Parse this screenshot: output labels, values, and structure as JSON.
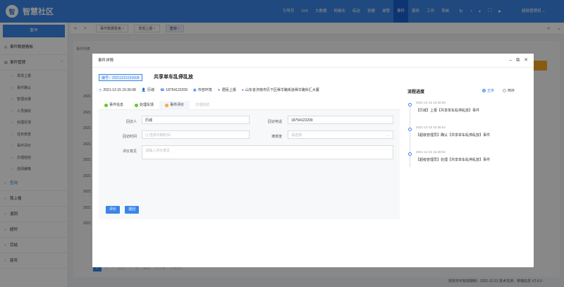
{
  "app": {
    "title": "智慧社区",
    "logo_glyph": "智",
    "accent": "#3a86e8"
  },
  "nav": {
    "items": [
      "引导页",
      "GIS",
      "大数据",
      "网格化",
      "综治",
      "党建",
      "城管",
      "事件",
      "服务",
      "工作",
      "系统"
    ],
    "active_index": 7,
    "user": "超级管理员 ⌄"
  },
  "sidebar": {
    "header": "事件",
    "board": "事件数据看板",
    "group": "事件管理",
    "subs": [
      "发现上报",
      "事件确认",
      "智理派遣",
      "人员接收",
      "处理反馈",
      "任务核查",
      "事件评价",
      "办理结结",
      "自闻编格"
    ],
    "items": [
      "查询",
      "我上报",
      "退回",
      "超时",
      "完结",
      "废弃"
    ]
  },
  "tabs": {
    "items": [
      "事件数据看板",
      "发现上报",
      "查询"
    ],
    "active_index": 2
  },
  "background": {
    "title": "事件列表",
    "rows": [
      "2021",
      "2021",
      "2021",
      "2021",
      "2021",
      "2021",
      "2021",
      "2021",
      "2021"
    ]
  },
  "pager": {
    "current": "1",
    "items": [
      "2",
      ">",
      "前往",
      "1",
      "页",
      "确定",
      "共 9 条",
      "10条/页 ⌄"
    ]
  },
  "footer": "授权许可有效期到：2021-12-31  技术支持：奇瑞信息  V2.6.0",
  "modal": {
    "title": "事件详情",
    "code": "编号：20211215153608",
    "event_title": "共享单车乱停乱放",
    "meta": [
      {
        "icon": "clock-icon",
        "glyph": "◷",
        "text": "2021-12-15 15:36:08"
      },
      {
        "icon": "user-icon",
        "glyph": "👤",
        "text": "历城"
      },
      {
        "icon": "phone-icon",
        "glyph": "☎",
        "text": "18754122209"
      },
      {
        "icon": "tag-icon",
        "glyph": "▣",
        "text": "市容环境"
      },
      {
        "icon": "send-icon",
        "glyph": "➤",
        "text": "居民上报"
      },
      {
        "icon": "location-icon",
        "glyph": "●",
        "text": "山东省济南市历下区舜华路街道舜华路科汇大厦"
      }
    ],
    "inner_tabs": [
      {
        "label": "事件信息",
        "status": "done",
        "color": "#52c41a"
      },
      {
        "label": "处理反馈",
        "status": "done",
        "color": "#52c41a"
      },
      {
        "label": "事件评价",
        "status": "current",
        "color": "#f6a623"
      },
      {
        "label": "办理结结",
        "status": "disabled",
        "color": ""
      }
    ],
    "form": {
      "visitor_label": "回访人",
      "visitor_value": "历城",
      "phone_label": "回访电话",
      "phone_value": "18754122209",
      "time_label": "回访时间",
      "time_placeholder": "选择日期时间",
      "satisfaction_label": "满意度",
      "satisfaction_placeholder": "请选择",
      "opinion_label": "评价意见",
      "opinion_placeholder": "请输入评价意见",
      "submit": "评价",
      "back": "退回"
    },
    "flow": {
      "title": "流程进度",
      "options": [
        "正序",
        "倒序"
      ],
      "selected": 0,
      "steps": [
        {
          "time": "2021-12-15 15:36:08",
          "text": "【历城】上报【共享单车乱停乱放】事件"
        },
        {
          "time": "2021-12-15 15:36:54",
          "text": "【超级管理员】确认【共享单车乱停乱放】事件"
        },
        {
          "time": "2021-12-15 15:38:04",
          "text": "【超级管理员】处理【共享单车乱停乱放】事件"
        }
      ]
    }
  }
}
